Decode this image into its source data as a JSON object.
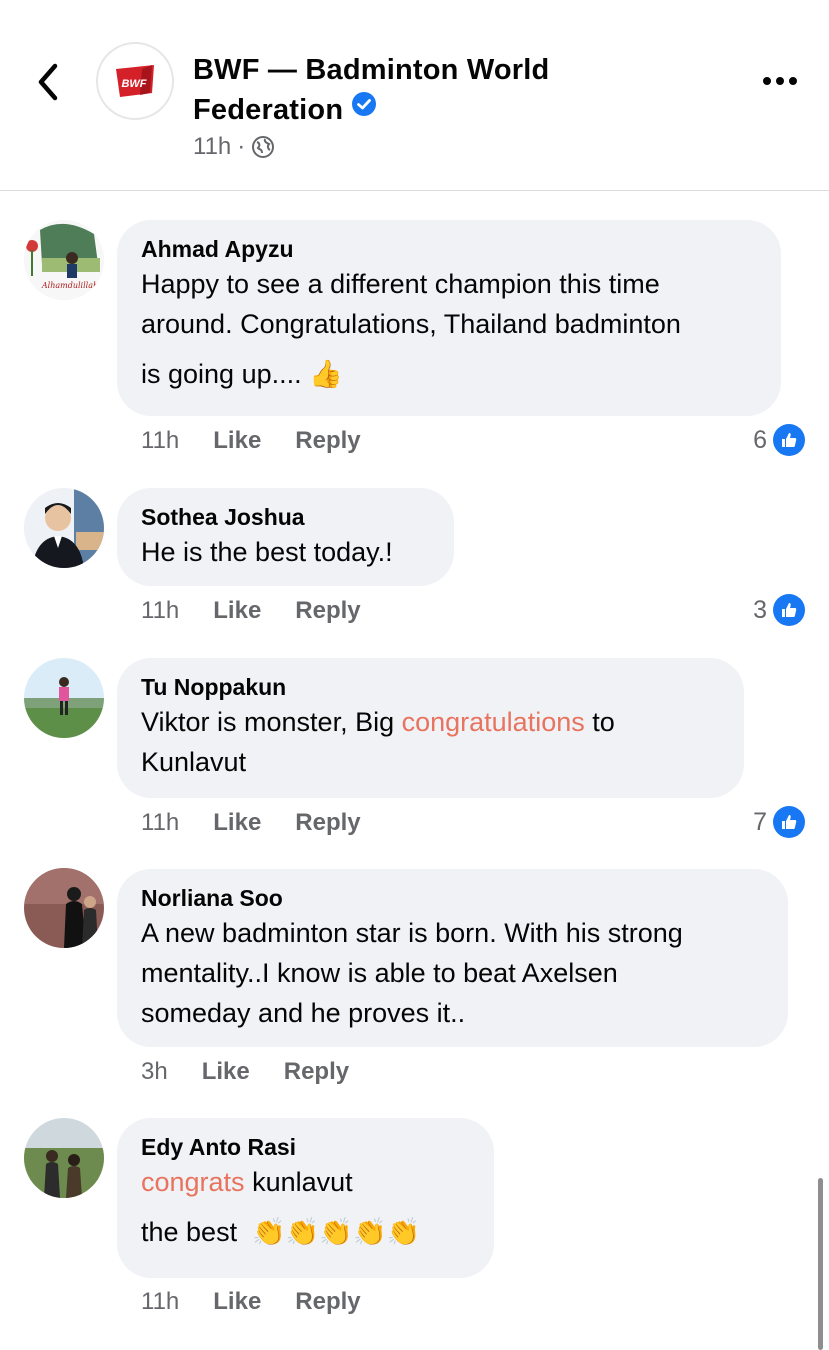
{
  "header": {
    "page_name": "BWF — Badminton World Federation",
    "page_name_line1": "BWF — Badminton World",
    "page_name_line2": "Federation",
    "time": "11h",
    "separator": "·",
    "logo_text": "BWF",
    "icons": {
      "back": "chevron-left-icon",
      "verified": "verified-badge-icon",
      "audience": "globe-icon",
      "more": "more-horizontal-icon"
    }
  },
  "colors": {
    "link_blue": "#1877f2",
    "bubble_bg": "#f0f2f5",
    "muted": "#65676b",
    "highlight": "#e8735e",
    "brand_red": "#d42029"
  },
  "comments": [
    {
      "author": "Ahmad Apyzu",
      "line1": "Happy to see a different champion this time",
      "line2": "around. Congratulations, Thailand badminton",
      "line3": "is going up....",
      "emoji": "👍",
      "avatar_caption": "Alhamdulillah",
      "time": "11h",
      "like": "Like",
      "reply": "Reply",
      "reactions": "6"
    },
    {
      "author": "Sothea Joshua",
      "line1": "He is the best today.!",
      "time": "11h",
      "like": "Like",
      "reply": "Reply",
      "reactions": "3"
    },
    {
      "author": "Tu Noppakun",
      "line1_a": "Viktor is monster, Big ",
      "line1_hl": "congratulations",
      "line1_b": " to",
      "line2": "Kunlavut",
      "time": "11h",
      "like": "Like",
      "reply": "Reply",
      "reactions": "7"
    },
    {
      "author": "Norliana Soo",
      "line1": "A new badminton star is born. With his strong",
      "line2": "mentality..I know is able to beat Axelsen",
      "line3": "someday and he proves it..",
      "time": "3h",
      "like": "Like",
      "reply": "Reply"
    },
    {
      "author": "Edy Anto Rasi",
      "line1_hl": "congrats",
      "line1_b": " kunlavut",
      "line2": "the best",
      "emoji": "👏👏👏👏👏",
      "time": "11h",
      "like": "Like",
      "reply": "Reply"
    }
  ]
}
